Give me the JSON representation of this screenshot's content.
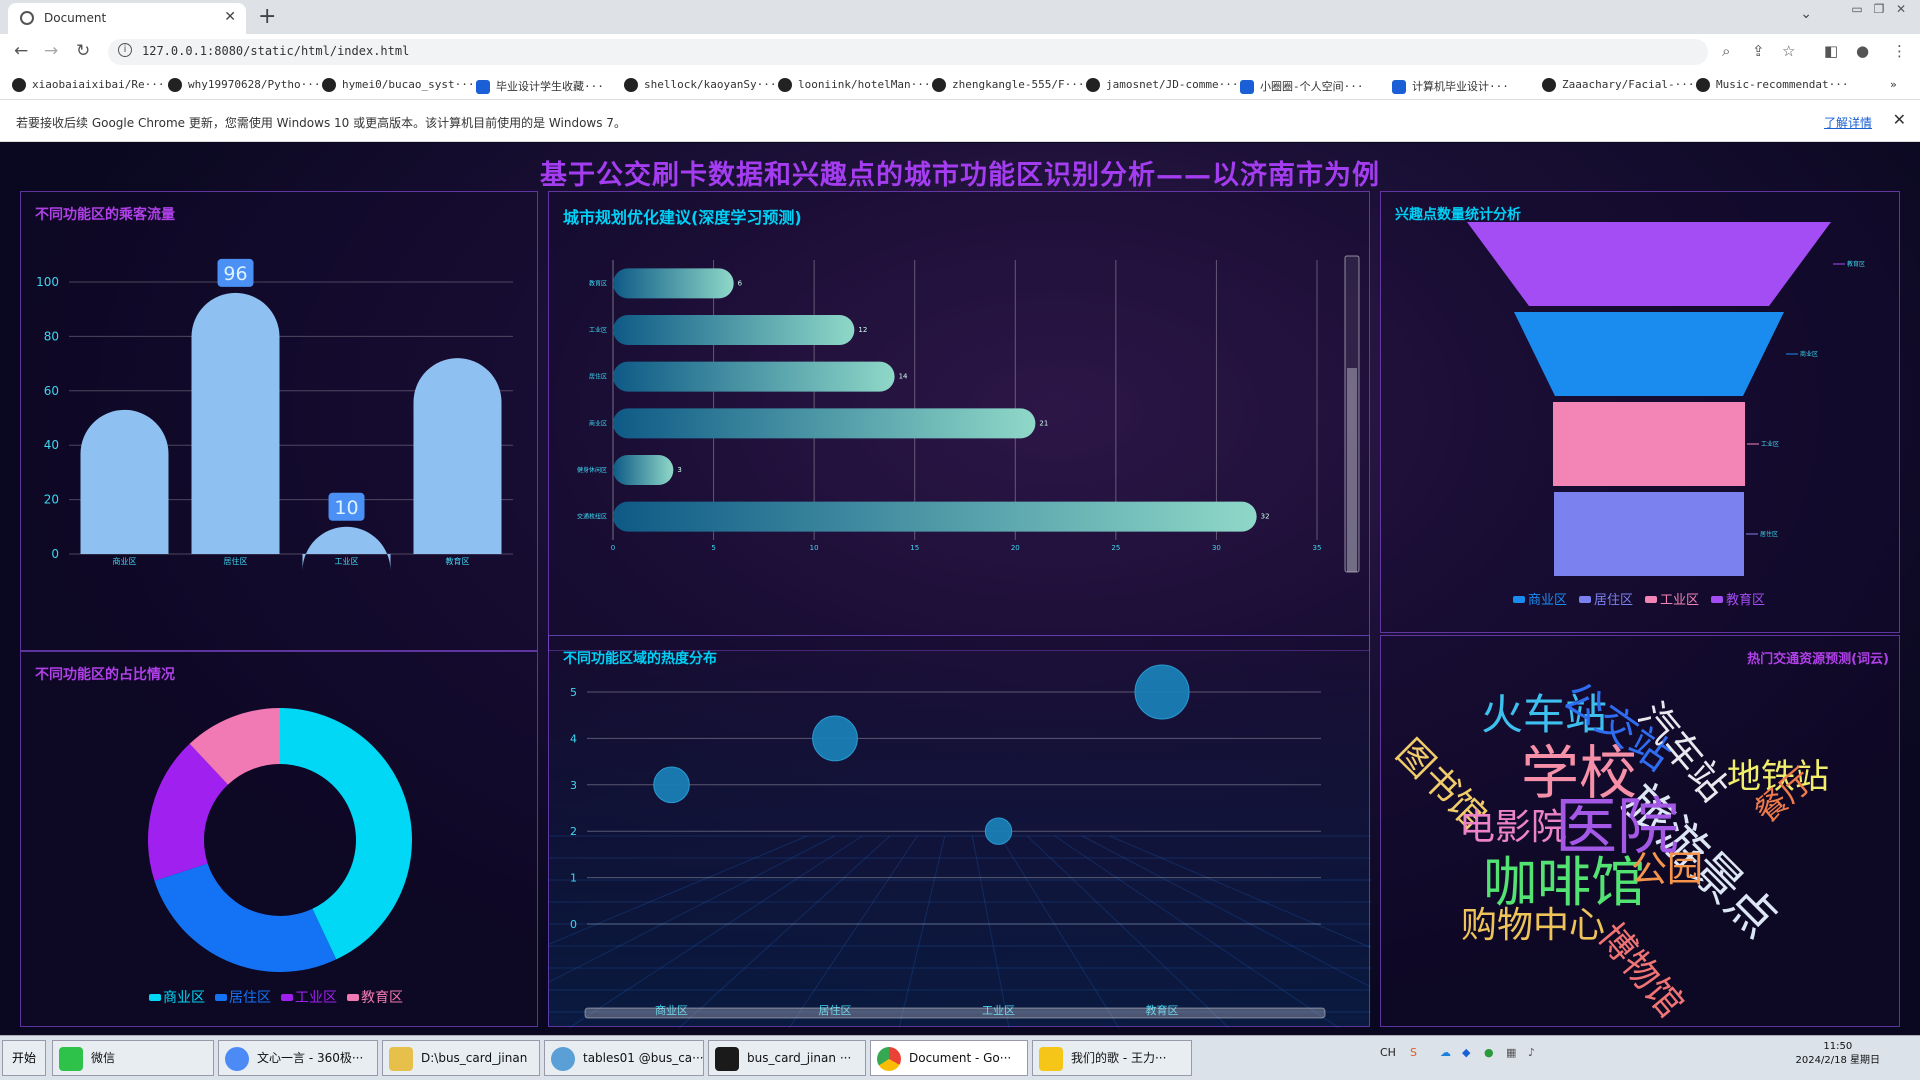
{
  "browser": {
    "tab_title": "Document",
    "url": "127.0.0.1:8080/static/html/index.html",
    "bookmarks": [
      "xiaobaiaixibai/Re···",
      "why19970628/Pytho···",
      "hymei0/bucao_syst···",
      "毕业设计学生收藏···",
      "shellock/kaoyanSy···",
      "looniink/hotelMan···",
      "zhengkangle-555/F···",
      "jamosnet/JD-comme···",
      "小圈圈-个人空间···",
      "计算机毕业设计···",
      "Zaaachary/Facial-···",
      "Music-recommendat···"
    ],
    "infobar_message": "若要接收后续 Google Chrome 更新，您需使用 Windows 10 或更高版本。该计算机目前使用的是 Windows 7。",
    "infobar_link": "了解详情"
  },
  "dashboard": {
    "title": "基于公交刷卡数据和兴趣点的城市功能区识别分析——以济南市为例",
    "panels": {
      "p1_title": "不同功能区的乘客流量",
      "p2_title": "城市规划优化建议(深度学习预测)",
      "p3_title": "兴趣点数量统计分析",
      "p4_title": "不同功能区的占比情况",
      "p5_title": "不同功能区域的热度分布",
      "p6_title": "热门交通资源预测(词云)"
    },
    "legend": [
      "商业区",
      "居住区",
      "工业区",
      "教育区"
    ],
    "legend_colors": [
      "#00d8f5",
      "#1473f5",
      "#a020f0",
      "#f27ab4"
    ],
    "funnel_colors": [
      "#a44df4",
      "#1a8cf0",
      "#f285b5",
      "#7b82f0"
    ]
  },
  "chart_data": [
    {
      "type": "bar",
      "title": "不同功能区的乘客流量",
      "categories": [
        "商业区",
        "居住区",
        "工业区",
        "教育区"
      ],
      "values": [
        53,
        96,
        10,
        72
      ],
      "labeled": [
        false,
        true,
        true,
        false
      ],
      "yticks": [
        "0",
        "20",
        "40",
        "60",
        "80",
        "100"
      ],
      "ylim": [
        0,
        100
      ]
    },
    {
      "type": "bar",
      "orientation": "horizontal",
      "title": "城市规划优化建议(深度学习预测)",
      "categories": [
        "教育区",
        "工业区",
        "居住区",
        "商业区",
        "健身休闲区",
        "交通枚纽区"
      ],
      "values": [
        6,
        12,
        14,
        21,
        3,
        32
      ],
      "xticks": [
        "0",
        "5",
        "10",
        "15",
        "20",
        "25",
        "30",
        "35"
      ],
      "xlim": [
        0,
        35
      ]
    },
    {
      "type": "funnel",
      "title": "兴趣点数量统计分析",
      "categories": [
        "教育区",
        "商业区",
        "工业区",
        "居住区"
      ]
    },
    {
      "type": "pie",
      "title": "不同功能区的占比情况",
      "categories": [
        "商业区",
        "居住区",
        "工业区",
        "教育区"
      ],
      "values": [
        43,
        27,
        18,
        12
      ],
      "donut": true
    },
    {
      "type": "scatter",
      "title": "不同功能区域的热度分布",
      "categories": [
        "商业区",
        "居住区",
        "工业区",
        "教育区"
      ],
      "values": [
        3,
        4,
        2,
        5
      ],
      "yticks": [
        "0",
        "1",
        "2",
        "3",
        "4",
        "5"
      ],
      "ylim": [
        0,
        5
      ]
    }
  ],
  "wordcloud": [
    {
      "text": "火车站",
      "color": "#3ec0ef"
    },
    {
      "text": "公交站",
      "color": "#2f6df0"
    },
    {
      "text": "汽车站",
      "color": "#e8e8ee"
    },
    {
      "text": "图书馆",
      "color": "#f0cc6a"
    },
    {
      "text": "学校",
      "color": "#f590a8"
    },
    {
      "text": "旅游景点",
      "color": "#dde6f5"
    },
    {
      "text": "地铁站",
      "color": "#f0ee6a"
    },
    {
      "text": "电影院",
      "color": "#ec83c8"
    },
    {
      "text": "医院",
      "color": "#a358e6"
    },
    {
      "text": "餐厅",
      "color": "#f07b4a"
    },
    {
      "text": "咖啡馆",
      "color": "#53e372"
    },
    {
      "text": "公园",
      "color": "#f5944a"
    },
    {
      "text": "购物中心",
      "color": "#eec45a"
    },
    {
      "text": "博物馆",
      "color": "#f07474"
    }
  ],
  "taskbar": {
    "start": "开始",
    "items": [
      "微信",
      "文心一言 - 360极···",
      "D:\\bus_card_jinan",
      "tables01 @bus_ca···",
      "bus_card_jinan ···",
      "Document - Go···",
      "我们的歌 - 王力···"
    ],
    "tray_lang": "CH",
    "time": "11:50",
    "date": "2024/2/18 星期日"
  }
}
